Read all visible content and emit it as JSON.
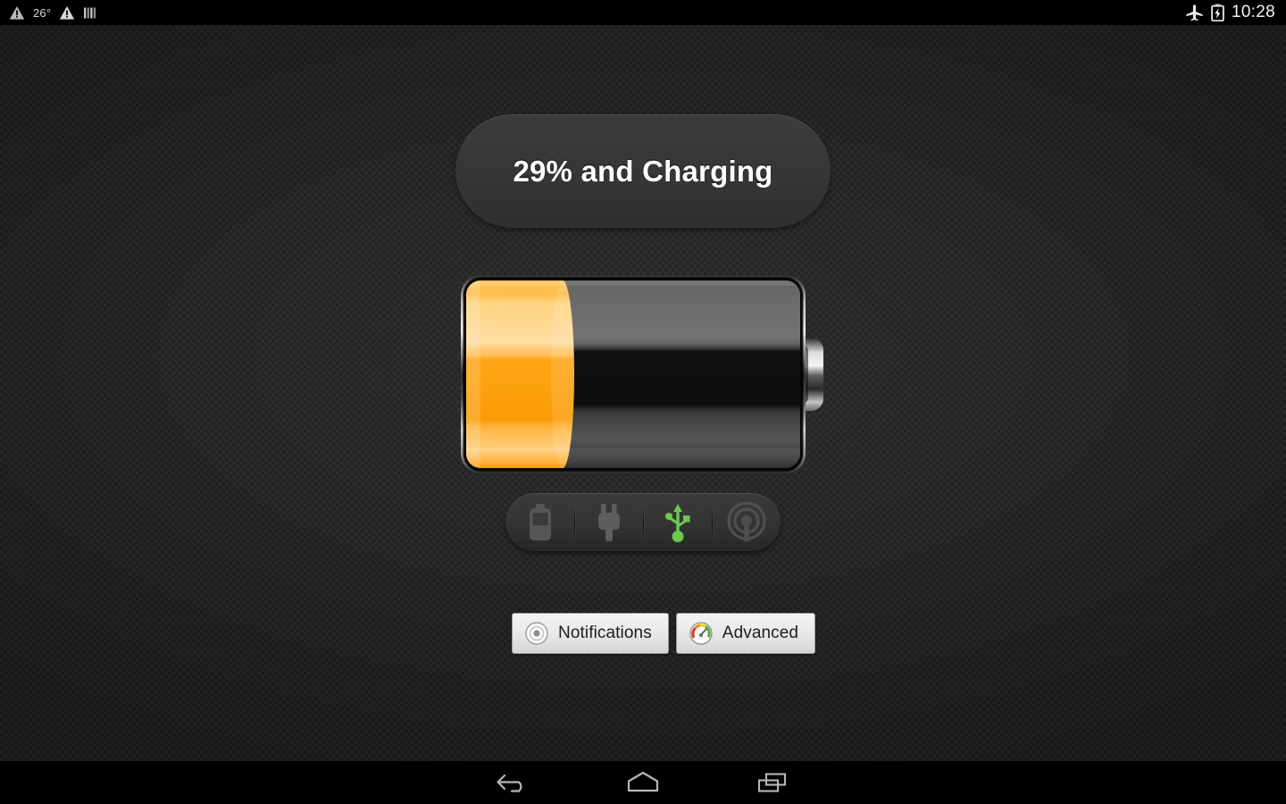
{
  "status_bar": {
    "temperature": "26°",
    "clock": "10:28",
    "left_icons": [
      {
        "name": "warning-triangle-icon",
        "label": "warning"
      },
      {
        "name": "warning-triangle-icon",
        "label": "warning"
      },
      {
        "name": "signal-bars-icon",
        "label": "signal bars"
      }
    ],
    "right_icons": [
      {
        "name": "airplane-mode-icon",
        "label": "airplane mode"
      },
      {
        "name": "battery-charging-icon",
        "label": "battery charging"
      }
    ]
  },
  "main": {
    "title": "29% and Charging",
    "battery": {
      "percent": 29,
      "fill_color": "#ffa013",
      "fill_color_light": "#ffcf7a",
      "casing_color": "#d9d9d9",
      "empty_color": "#141414"
    },
    "sources": [
      {
        "name": "battery-source-icon",
        "label": "Battery",
        "active": false
      },
      {
        "name": "ac-plug-icon",
        "label": "AC",
        "active": false
      },
      {
        "name": "usb-icon",
        "label": "USB",
        "active": true
      },
      {
        "name": "wireless-charging-icon",
        "label": "Wireless",
        "active": false
      }
    ],
    "active_color": "#6ec850",
    "inactive_color": "#5a5a5a",
    "buttons": [
      {
        "name": "notifications-button",
        "label": "Notifications",
        "icon": "notification-dot-icon"
      },
      {
        "name": "advanced-button",
        "label": "Advanced",
        "icon": "gauge-icon"
      }
    ]
  },
  "nav_bar": {
    "buttons": [
      {
        "name": "nav-back-button",
        "label": "Back"
      },
      {
        "name": "nav-home-button",
        "label": "Home"
      },
      {
        "name": "nav-recents-button",
        "label": "Recent apps"
      }
    ]
  }
}
